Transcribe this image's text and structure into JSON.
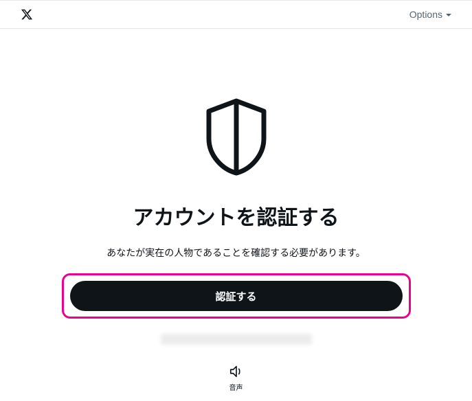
{
  "header": {
    "options_label": "Options"
  },
  "main": {
    "title": "アカウントを認証する",
    "subtitle": "あなたが実在の人物であることを確認する必要があります。",
    "auth_button_label": "認証する",
    "audio_label": "音声"
  },
  "icons": {
    "logo": "x-logo",
    "shield": "shield-icon",
    "audio": "volume-icon",
    "caret": "chevron-down-icon"
  },
  "colors": {
    "highlight": "#ec008c",
    "button_bg": "#0f1419",
    "text": "#0f1419",
    "muted": "#536471"
  }
}
